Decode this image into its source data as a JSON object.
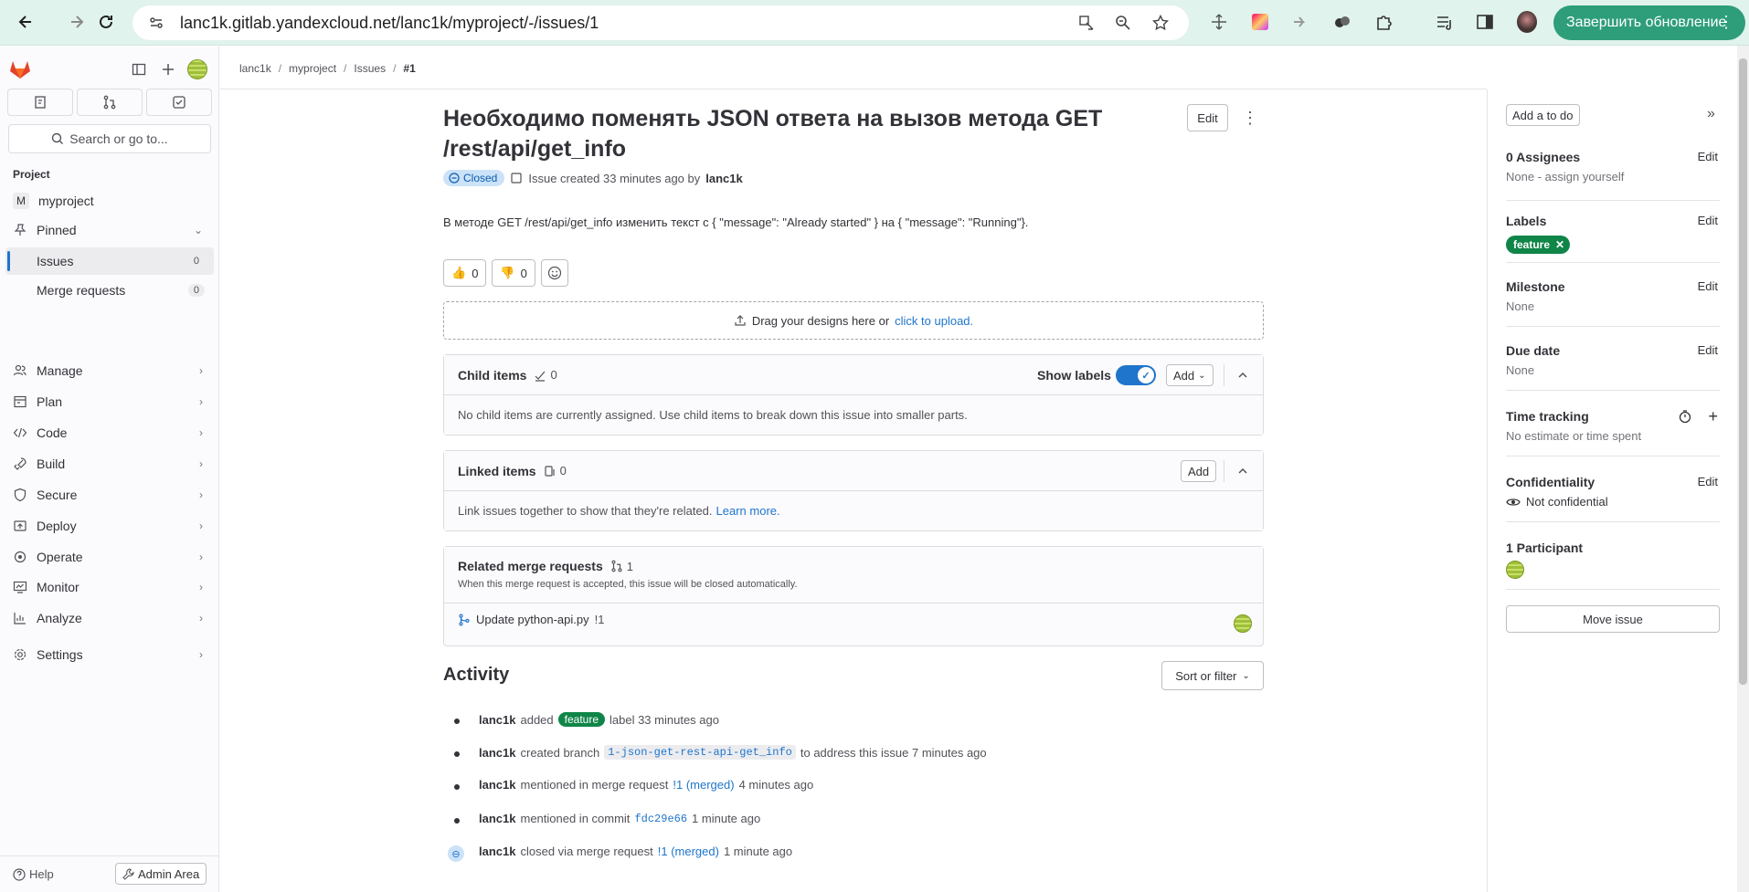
{
  "browser": {
    "url": "lanc1k.gitlab.yandexcloud.net/lanc1k/myproject/-/issues/1",
    "update_label": "Завершить обновление"
  },
  "sidebar": {
    "search_label": "Search or go to...",
    "section_label": "Project",
    "project_initial": "M",
    "project_name": "myproject",
    "pinned_label": "Pinned",
    "issues_label": "Issues",
    "issues_count": "0",
    "mr_label": "Merge requests",
    "mr_count": "0",
    "items": [
      {
        "label": "Manage",
        "icon": "users-icon"
      },
      {
        "label": "Plan",
        "icon": "plan-icon"
      },
      {
        "label": "Code",
        "icon": "code-icon"
      },
      {
        "label": "Build",
        "icon": "rocket-icon"
      },
      {
        "label": "Secure",
        "icon": "shield-icon"
      },
      {
        "label": "Deploy",
        "icon": "deploy-icon"
      },
      {
        "label": "Operate",
        "icon": "cloud-icon"
      },
      {
        "label": "Monitor",
        "icon": "monitor-icon"
      },
      {
        "label": "Analyze",
        "icon": "chart-icon"
      },
      {
        "label": "Settings",
        "icon": "gear-icon"
      }
    ],
    "help_label": "Help",
    "admin_label": "Admin Area"
  },
  "breadcrumb": [
    "lanc1k",
    "myproject",
    "Issues",
    "#1"
  ],
  "issue": {
    "title": "Необходимо поменять JSON ответа на вызов метода GET /rest/api/get_info",
    "edit_label": "Edit",
    "status": "Closed",
    "created_text": "Issue created 33 minutes ago by",
    "author": "lanc1k",
    "description": "В методе GET /rest/api/get_info изменить текст с { \"message\": \"Already started\" } на { \"message\": \"Running\"}.",
    "thumbs_up": "0",
    "thumbs_down": "0",
    "drop_text": "Drag your designs here or",
    "drop_link": "click to upload."
  },
  "child_items": {
    "title": "Child items",
    "count": "0",
    "show_labels": "Show labels",
    "add_label": "Add",
    "empty_text": "No child items are currently assigned. Use child items to break down this issue into smaller parts."
  },
  "linked_items": {
    "title": "Linked items",
    "count": "0",
    "add_label": "Add",
    "text": "Link issues together to show that they're related.",
    "learn_more": "Learn more."
  },
  "related_mr": {
    "title": "Related merge requests",
    "count": "1",
    "subtitle": "When this merge request is accepted, this issue will be closed automatically.",
    "mr_title": "Update python-api.py",
    "mr_ref": "!1"
  },
  "activity": {
    "title": "Activity",
    "sort_label": "Sort or filter",
    "entries": [
      {
        "user": "lanc1k",
        "pre": "added",
        "pill": "feature",
        "post": "label 33 minutes ago"
      },
      {
        "user": "lanc1k",
        "pre": "created branch",
        "code": "1-json-get-rest-api-get_info",
        "post": "to address this issue 7 minutes ago"
      },
      {
        "user": "lanc1k",
        "pre": "mentioned in merge request",
        "link": "!1 (merged)",
        "post": "4 minutes ago"
      },
      {
        "user": "lanc1k",
        "pre": "mentioned in commit",
        "commit": "fdc29e66",
        "post": "1 minute ago"
      },
      {
        "user": "lanc1k",
        "pre": "closed via merge request",
        "link": "!1 (merged)",
        "post": "1 minute ago"
      }
    ]
  },
  "right_sidebar": {
    "todo_label": "Add a to do",
    "assignees_title": "0 Assignees",
    "assignees_value": "None - assign yourself",
    "labels_title": "Labels",
    "label_name": "feature",
    "milestone_title": "Milestone",
    "milestone_value": "None",
    "due_title": "Due date",
    "due_value": "None",
    "time_title": "Time tracking",
    "time_value": "No estimate or time spent",
    "conf_title": "Confidentiality",
    "conf_value": "Not confidential",
    "participants_title": "1 Participant",
    "edit_label": "Edit",
    "move_label": "Move issue"
  },
  "colors": {
    "accent": "#1f75cb",
    "label_green": "#108548",
    "browser_green": "#2e9e7a"
  }
}
